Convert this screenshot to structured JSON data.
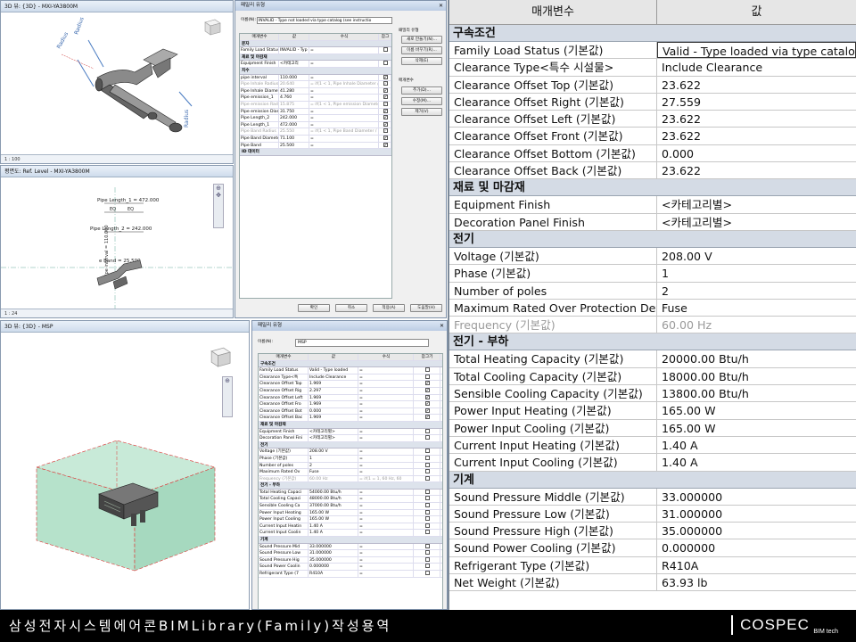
{
  "viewports": {
    "top": {
      "title": "3D 뷰: {3D} - MXI-YA3800M",
      "scale": "1 : 100",
      "radius_labels": [
        "Radius",
        "Radius",
        "Radius"
      ]
    },
    "mid": {
      "title": "평면도: Ref. Level - MXI-YA3800M",
      "scale": "1 : 24",
      "dims": {
        "len1": "Pipe Length_1 = 472.000",
        "eq1": "EQ",
        "eq2": "EQ",
        "len2": "Pipe Length_2 = 242.000",
        "band": "e Band = 25.500",
        "interval": "pipe interval = 110.000"
      }
    },
    "bot": {
      "title": "3D 뷰: {3D} - MSP"
    }
  },
  "dialog_top": {
    "title": "패밀리 유형",
    "name_label": "이름(N):",
    "name_value": "INVALID - Type not loaded via type catalog (see instructio",
    "side": {
      "group1": "패밀리 유형",
      "new": "새로 만들기(N)...",
      "rename": "이름 바꾸기(R)...",
      "delete": "삭제(E)",
      "group2": "매개변수",
      "add": "추가(D)...",
      "modify": "수정(M)...",
      "remove": "제거(V)"
    },
    "headers": [
      "매개변수",
      "값",
      "수식",
      "잠그"
    ],
    "groups": [
      {
        "name": "문자",
        "rows": [
          [
            "Family Load Status",
            "INVALID - Typ",
            "="
          ]
        ]
      },
      {
        "name": "재료 및 마감재",
        "rows": [
          [
            "Equipment Finish",
            "<카테고리",
            "="
          ]
        ]
      },
      {
        "name": "치수",
        "rows": [
          [
            "pipe interval",
            "110.000",
            "="
          ],
          [
            "Pipe Inhale Radius",
            "20.640",
            "= if(1 < 1, Pipe Inhale Diameter / 2,"
          ],
          [
            "Pipe Inhale Diameter",
            "41.280",
            "="
          ],
          [
            "Pipe emission_1",
            "4.760",
            "="
          ],
          [
            "Pipe emission Radius",
            "15.875",
            "= if(1 < 1, Pipe emission Diameter"
          ],
          [
            "Pipe emission Diame",
            "31.750",
            "="
          ],
          [
            "Pipe Length_2",
            "242.000",
            "="
          ],
          [
            "Pipe Length_1",
            "472.000",
            "="
          ],
          [
            "Pipe Band Radius",
            "25.550",
            "= if(1 < 1, Pipe Band Diameter / 2,"
          ],
          [
            "Pipe Band Diameter",
            "71.100",
            "="
          ],
          [
            "Pipe Band",
            "25.500",
            "="
          ]
        ]
      },
      {
        "name": "ID 데이터",
        "rows": []
      }
    ],
    "buttons": {
      "ok": "확인",
      "cancel": "취소",
      "apply": "적용(A)",
      "help": "도움말(H)"
    }
  },
  "dialog_bot": {
    "title": "패밀리 유형",
    "name_label": "이름(N):",
    "name_value": "MSP",
    "headers": [
      "매개변수",
      "값",
      "수식",
      "잠그기"
    ],
    "groups": [
      {
        "name": "구속조건",
        "rows": [
          [
            "Family Load Status",
            "Valid - Type loaded",
            "="
          ],
          [
            "Clearance Type<특",
            "Include Clearance",
            "="
          ],
          [
            "Clearance Offset Top",
            "1.969",
            "="
          ],
          [
            "Clearance Offset Rig",
            "2.297",
            "="
          ],
          [
            "Clearance Offset Left",
            "1.969",
            "="
          ],
          [
            "Clearance Offset Fro",
            "1.969",
            "="
          ],
          [
            "Clearance Offset Bot",
            "0.000",
            "="
          ],
          [
            "Clearance Offset Bac",
            "1.969",
            "="
          ]
        ]
      },
      {
        "name": "재료 및 마감재",
        "rows": [
          [
            "Equipment Finish",
            "<카테고리별>",
            "="
          ],
          [
            "Decoration Panel Fini",
            "<카테고리별>",
            "="
          ]
        ]
      },
      {
        "name": "전기",
        "rows": [
          [
            "Voltage (기본값)",
            "208.00 V",
            "="
          ],
          [
            "Phase (기본값)",
            "1",
            "="
          ],
          [
            "Number of poles",
            "2",
            "="
          ],
          [
            "Maximum Rated Ov",
            "Fuse",
            "="
          ],
          [
            "Frequency (기본값)",
            "60.00 Hz",
            "= if(1 = 1, 60 Hz, 60"
          ]
        ]
      },
      {
        "name": "전기 - 부하",
        "rows": [
          [
            "Total Heating Capaci",
            "54000.00 Btu/h",
            "="
          ],
          [
            "Total Cooling Capaci",
            "48000.00 Btu/h",
            "="
          ],
          [
            "Sensible Cooling Ca",
            "37000.00 Btu/h",
            "="
          ],
          [
            "Power Input Heating",
            "165.00 W",
            "="
          ],
          [
            "Power Input Cooling",
            "165.00 W",
            "="
          ],
          [
            "Current Input Heatin",
            "1.40 A",
            "="
          ],
          [
            "Current Input Coolin",
            "1.40 A",
            "="
          ]
        ]
      },
      {
        "name": "기계",
        "rows": [
          [
            "Sound Pressure Mid",
            "33.000000",
            "="
          ],
          [
            "Sound Pressure Low",
            "31.000000",
            "="
          ],
          [
            "Sound Pressure Hig",
            "35.000000",
            "="
          ],
          [
            "Sound Power Coolin",
            "0.000000",
            "="
          ],
          [
            "Refrigerant Type (7",
            "R410A",
            "="
          ]
        ]
      }
    ]
  },
  "table": {
    "headers": [
      "매개변수",
      "값"
    ],
    "groups": [
      {
        "name": "구속조건",
        "rows": [
          [
            "Family Load Status (기본값)",
            "Valid - Type loaded via type catalog"
          ],
          [
            "Clearance Type<특수 시설물>",
            "Include Clearance"
          ],
          [
            "Clearance Offset Top (기본값)",
            "23.622"
          ],
          [
            "Clearance Offset Right (기본값)",
            "27.559"
          ],
          [
            "Clearance Offset Left (기본값)",
            "23.622"
          ],
          [
            "Clearance Offset Front (기본값)",
            "23.622"
          ],
          [
            "Clearance Offset Bottom (기본값)",
            "0.000"
          ],
          [
            "Clearance Offset Back (기본값)",
            "23.622"
          ]
        ]
      },
      {
        "name": "재료 및 마감재",
        "rows": [
          [
            "Equipment Finish",
            "<카테고리별>"
          ],
          [
            "Decoration Panel Finish",
            "<카테고리별>"
          ]
        ]
      },
      {
        "name": "전기",
        "rows": [
          [
            "Voltage (기본값)",
            "208.00 V"
          ],
          [
            "Phase (기본값)",
            "1"
          ],
          [
            "Number of poles",
            "2"
          ],
          [
            "Maximum Rated Over Protection Devic",
            "Fuse"
          ],
          [
            "Frequency (기본값)",
            "60.00 Hz"
          ]
        ]
      },
      {
        "name": "전기 - 부하",
        "rows": [
          [
            "Total Heating Capacity (기본값)",
            "20000.00 Btu/h"
          ],
          [
            "Total Cooling Capacity (기본값)",
            "18000.00 Btu/h"
          ],
          [
            "Sensible Cooling Capacity (기본값)",
            "13800.00 Btu/h"
          ],
          [
            "Power Input Heating (기본값)",
            "165.00 W"
          ],
          [
            "Power Input Cooling (기본값)",
            "165.00 W"
          ],
          [
            "Current Input Heating (기본값)",
            "1.40 A"
          ],
          [
            "Current Input Cooling (기본값)",
            "1.40 A"
          ]
        ]
      },
      {
        "name": "기계",
        "rows": [
          [
            "Sound Pressure Middle (기본값)",
            "33.000000"
          ],
          [
            "Sound Pressure Low (기본값)",
            "31.000000"
          ],
          [
            "Sound Pressure High (기본값)",
            "35.000000"
          ],
          [
            "Sound Power Cooling (기본값)",
            "0.000000"
          ],
          [
            "Refrigerant Type (기본값)",
            "R410A"
          ],
          [
            "Net Weight (기본값)",
            "63.93 lb"
          ]
        ]
      }
    ]
  },
  "footer": {
    "caption": "삼성전자시스템에어콘BIMLibrary(Family)작성용역",
    "logo_main": "COSPEC",
    "logo_sub": "BIM tech"
  }
}
